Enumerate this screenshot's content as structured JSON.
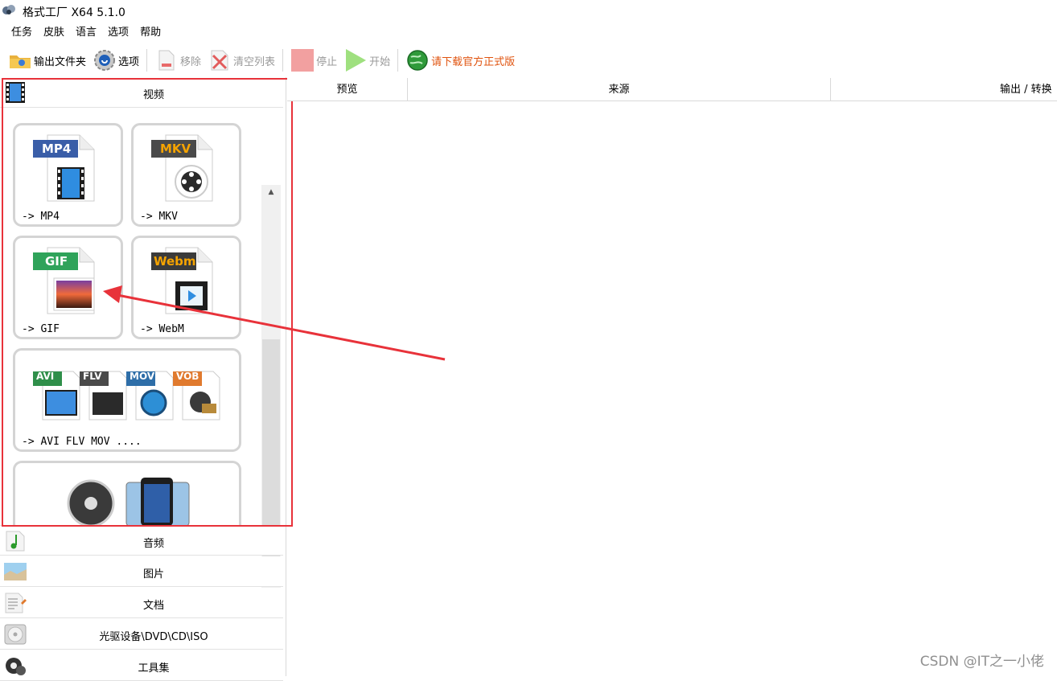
{
  "window": {
    "title": "格式工厂 X64 5.1.0"
  },
  "menu": [
    "任务",
    "皮肤",
    "语言",
    "选项",
    "帮助"
  ],
  "toolbar": {
    "output_folder": "输出文件夹",
    "options": "选项",
    "remove": "移除",
    "clear_list": "清空列表",
    "stop": "停止",
    "start": "开始",
    "download": "请下载官方正式版"
  },
  "categories": {
    "video": "视频",
    "audio": "音频",
    "image": "图片",
    "document": "文档",
    "disc": "光驱设备\\DVD\\CD\\ISO",
    "tools": "工具集"
  },
  "cards": {
    "mp4": {
      "badge": "MP4",
      "label": "-> MP4"
    },
    "mkv": {
      "badge": "MKV",
      "label": "-> MKV"
    },
    "gif": {
      "badge": "GIF",
      "label": "-> GIF"
    },
    "webm": {
      "badge": "Webm",
      "label": "-> WebM"
    },
    "multi": {
      "badges": [
        "AVI",
        "FLV",
        "MOV",
        "VOB"
      ],
      "label": "-> AVI FLV MOV ...."
    }
  },
  "task_columns": {
    "preview": "预览",
    "source": "来源",
    "output": "输出 / 转换"
  },
  "watermark": "CSDN @IT之一小佬",
  "colors": {
    "highlight_red": "#e8323a",
    "download_link": "#e0530e",
    "mp4_badge": "#3a5ea8",
    "mkv_badge": "#4a4a4a",
    "gif_badge": "#2fa35a",
    "webm_badge": "#3b3b3b"
  }
}
